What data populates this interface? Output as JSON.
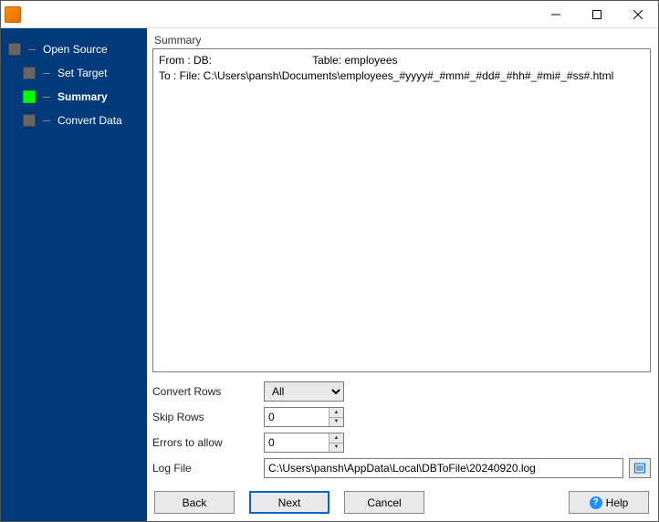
{
  "sidebar": {
    "items": [
      {
        "label": "Open Source"
      },
      {
        "label": "Set Target"
      },
      {
        "label": "Summary"
      },
      {
        "label": "Convert Data"
      }
    ]
  },
  "main": {
    "section_title": "Summary",
    "summary": {
      "from_db": "From : DB:",
      "from_table": "Table: employees",
      "to": "To : File: C:\\Users\\pansh\\Documents\\employees_#yyyy#_#mm#_#dd#_#hh#_#mi#_#ss#.html"
    },
    "form": {
      "convert_rows_label": "Convert Rows",
      "convert_rows_value": "All",
      "skip_rows_label": "Skip Rows",
      "skip_rows_value": "0",
      "errors_label": "Errors to allow",
      "errors_value": "0",
      "log_file_label": "Log File",
      "log_file_value": "C:\\Users\\pansh\\AppData\\Local\\DBToFile\\20240920.log"
    },
    "buttons": {
      "back": "Back",
      "next": "Next",
      "cancel": "Cancel",
      "help": "Help"
    }
  }
}
